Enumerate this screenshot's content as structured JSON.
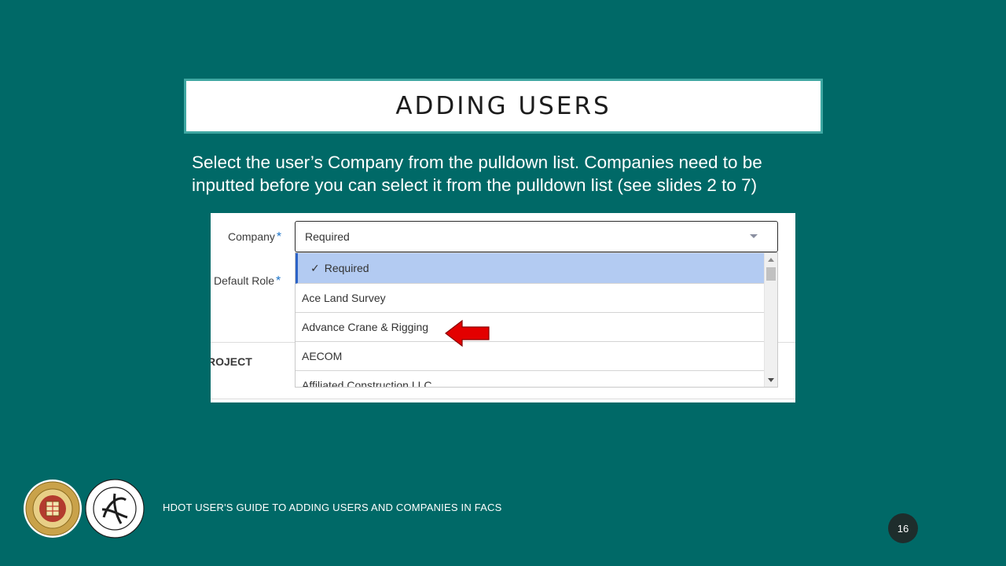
{
  "slide": {
    "title": "ADDING USERS",
    "instructions": "Select the user’s Company from the pulldown list.  Companies need to be inputted before you can select it from the pulldown list (see slides 2 to 7)",
    "footer": "HDOT USER'S GUIDE TO ADDING USERS AND COMPANIES IN FACS",
    "page_number": "16"
  },
  "form": {
    "company_label": "Company",
    "required_star": "*",
    "default_role_label": "Default Role",
    "section_label": "ROJECT",
    "company_select": {
      "value": "Required",
      "options": [
        {
          "label": "Required",
          "selected": true,
          "check": "✓"
        },
        {
          "label": "Ace Land Survey",
          "selected": false
        },
        {
          "label": "Advance Crane & Rigging",
          "selected": false
        },
        {
          "label": "AECOM",
          "selected": false
        },
        {
          "label": "Affiliated Construction LLC",
          "selected": false
        }
      ]
    }
  },
  "colors": {
    "background": "#006967",
    "title_border": "#3fa7a2",
    "selected_option": "#b3cbf2",
    "pointer_arrow": "#e30000"
  },
  "icons": {
    "pointer": "red-left-arrow-icon",
    "dropdown_caret": "chevron-down-icon",
    "check": "checkmark-icon"
  }
}
